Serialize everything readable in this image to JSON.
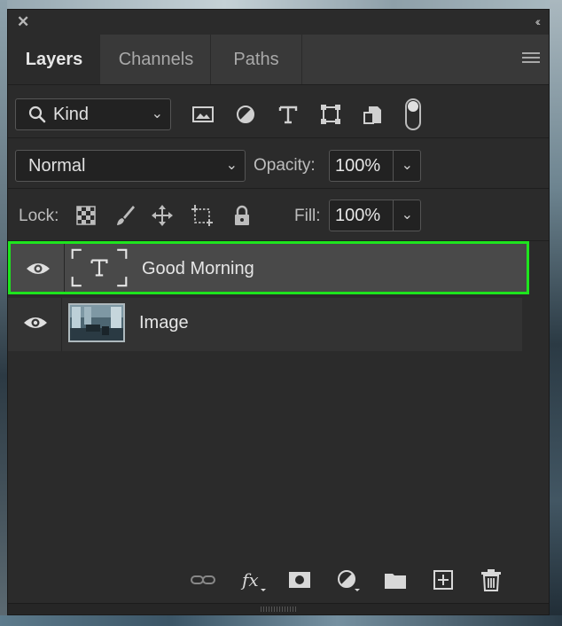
{
  "tabs": [
    {
      "label": "Layers",
      "active": true
    },
    {
      "label": "Channels",
      "active": false
    },
    {
      "label": "Paths",
      "active": false
    }
  ],
  "filter": {
    "kind_label": "Kind",
    "icons": [
      "image-filter-icon",
      "adjustment-filter-icon",
      "type-filter-icon",
      "shape-filter-icon",
      "smart-object-filter-icon"
    ]
  },
  "blend": {
    "mode": "Normal",
    "opacity_label": "Opacity:",
    "opacity_value": "100%"
  },
  "lock": {
    "label": "Lock:",
    "fill_label": "Fill:",
    "fill_value": "100%"
  },
  "layers": [
    {
      "name": "Good Morning",
      "type": "text",
      "selected": true
    },
    {
      "name": "Image",
      "type": "image",
      "selected": false
    }
  ],
  "colors": {
    "selection_outline": "#1ee51e",
    "panel_bg": "#2b2b2b"
  }
}
